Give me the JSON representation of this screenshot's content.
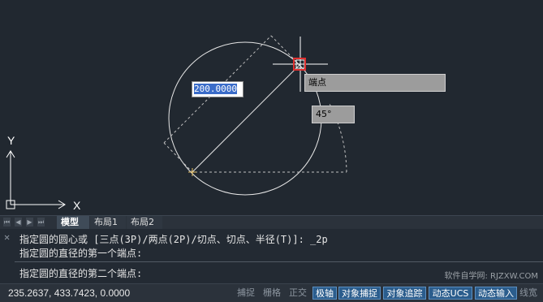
{
  "canvas": {
    "input_value": "200.0000",
    "tooltip_endpoint": "端点",
    "tooltip_angle": "45°",
    "y_axis_label": "Y",
    "x_axis_label": "X"
  },
  "layout_tabs": {
    "model": "模型",
    "layout1": "布局1",
    "layout2": "布局2"
  },
  "command": {
    "close_glyph": "✕",
    "history": [
      "指定圆的圆心或 [三点(3P)/两点(2P)/切点、切点、半径(T)]: _2p",
      "指定圆的直径的第一个端点:"
    ],
    "prompt": "指定圆的直径的第二个端点:",
    "watermark": "软件自学网: RJZXW.COM"
  },
  "status": {
    "coordinates": "235.2637, 433.7423, 0.0000",
    "buttons": [
      {
        "label": "捕捉",
        "on": false
      },
      {
        "label": "栅格",
        "on": false
      },
      {
        "label": "正交",
        "on": false
      },
      {
        "label": "极轴",
        "on": true
      },
      {
        "label": "对象捕捉",
        "on": true
      },
      {
        "label": "对象追踪",
        "on": true
      },
      {
        "label": "动态UCS",
        "on": true
      },
      {
        "label": "动态输入",
        "on": true
      },
      {
        "label": "线宽",
        "on": false
      }
    ]
  },
  "colors": {
    "background": "#212830",
    "snap_marker": "#e03030",
    "base_point": "#e8c060"
  }
}
